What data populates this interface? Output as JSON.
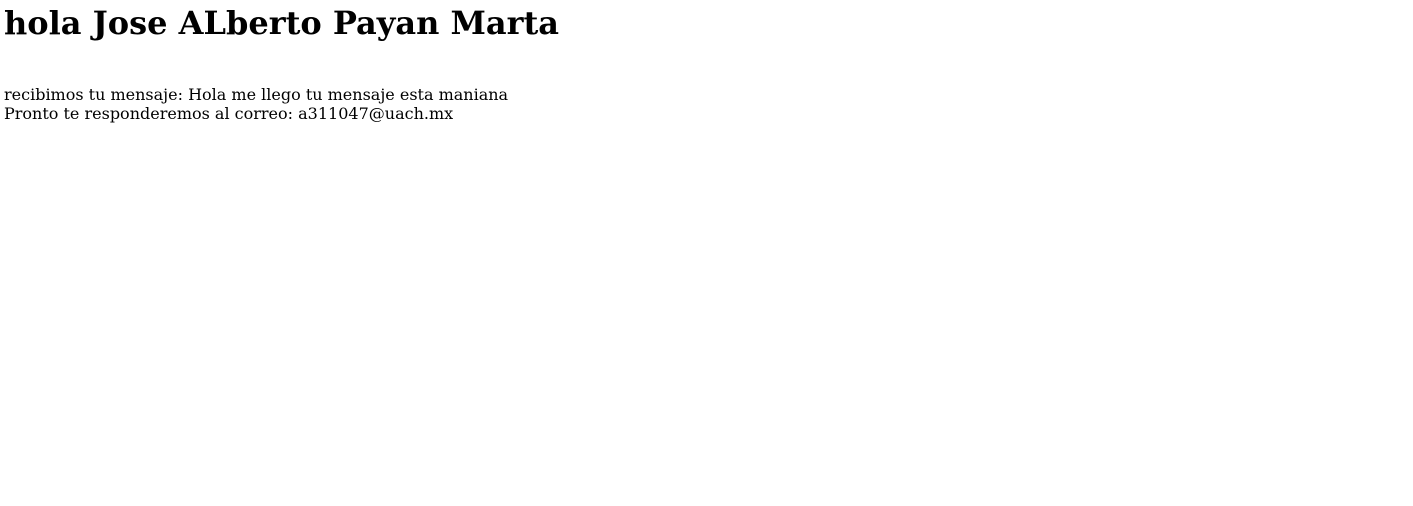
{
  "heading": {
    "greeting": "hola",
    "name": "Jose ALberto Payan Marta"
  },
  "message": {
    "received_label": "recibimos tu mensaje:",
    "text": "Hola me llego tu mensaje esta maniana"
  },
  "reply": {
    "label": "Pronto te responderemos al correo:",
    "email": "a311047@uach.mx"
  }
}
